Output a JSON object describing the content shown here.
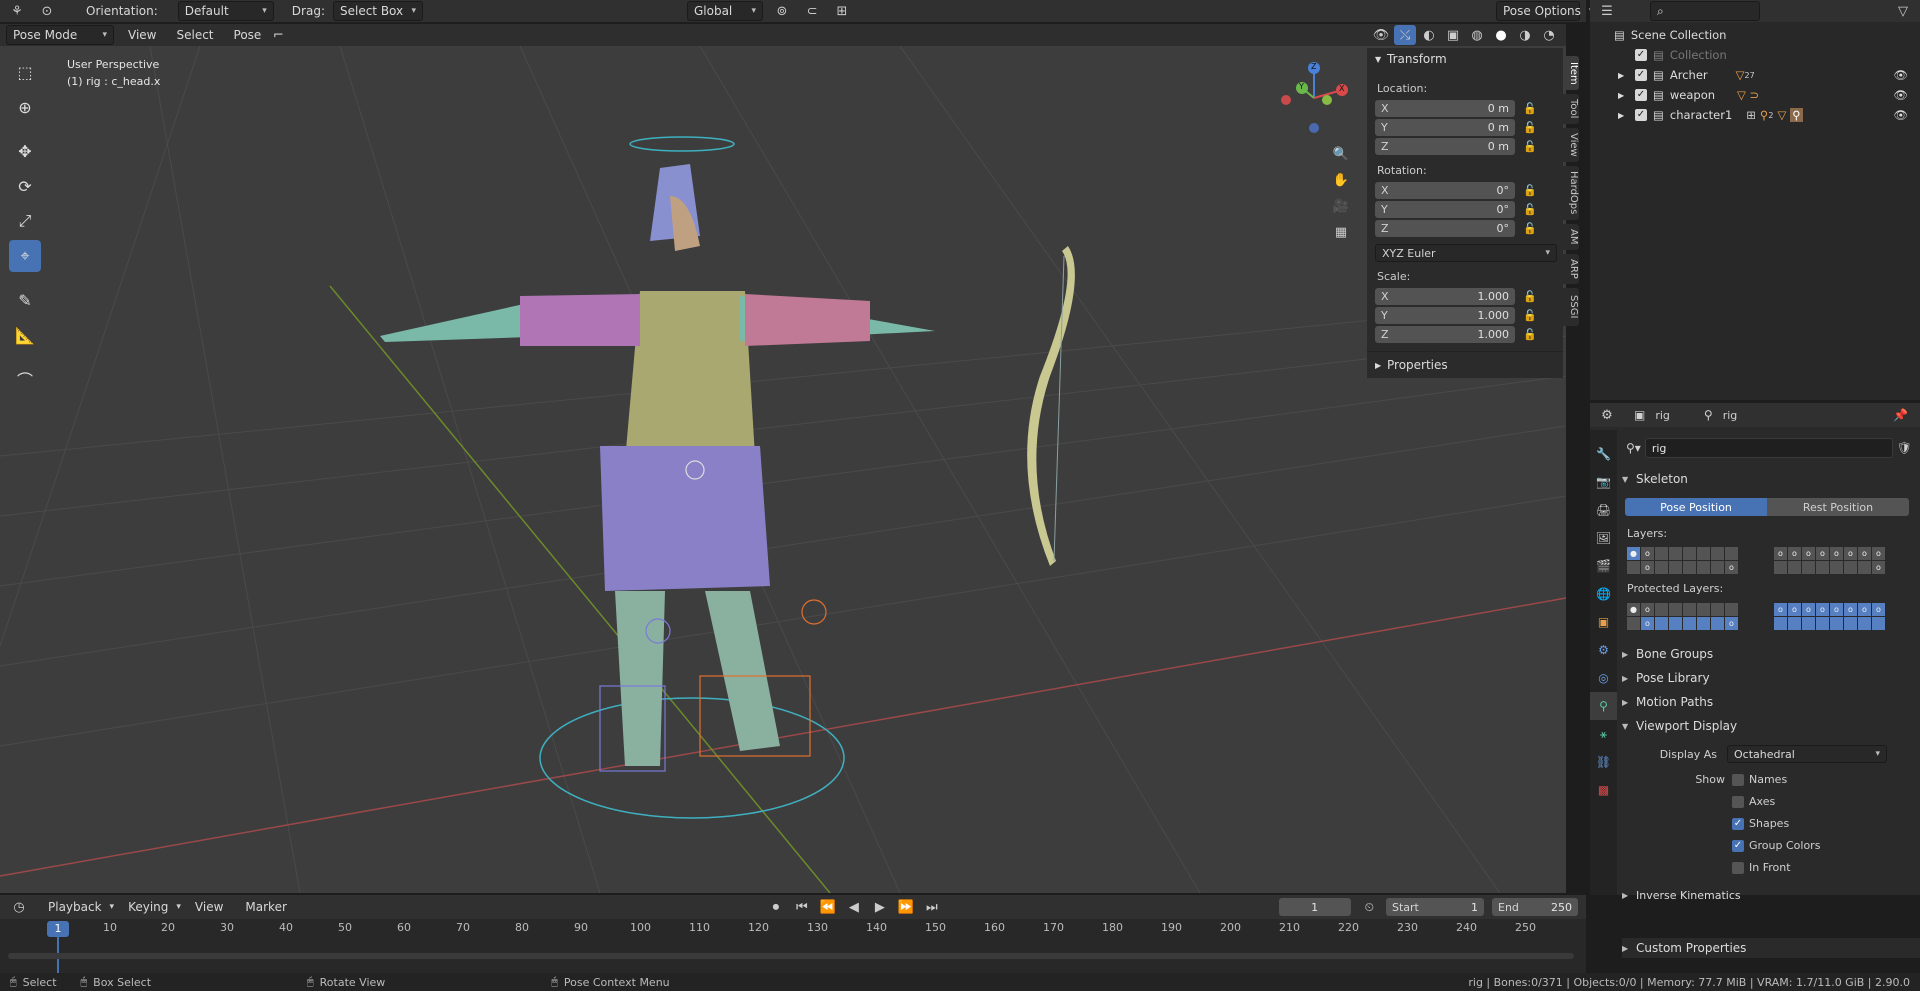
{
  "topbar": {
    "mode_icon": "editor-type-icon",
    "orientation_label": "Orientation:",
    "orientation_value": "Default",
    "drag_label": "Drag:",
    "drag_value": "Select Box",
    "transform_space": "Global",
    "pose_options": "Pose Options"
  },
  "viewport_header": {
    "mode": "Pose Mode",
    "menus": [
      "View",
      "Select",
      "Pose"
    ]
  },
  "viewport": {
    "title": "User Perspective",
    "subtitle": "(1) rig : c_head.x",
    "gizmo": {
      "x": "X",
      "y": "Y",
      "z": "Z"
    }
  },
  "npanel": {
    "transform_title": "Transform",
    "location_label": "Location:",
    "location": [
      {
        "k": "X",
        "v": "0 m"
      },
      {
        "k": "Y",
        "v": "0 m"
      },
      {
        "k": "Z",
        "v": "0 m"
      }
    ],
    "rotation_label": "Rotation:",
    "rotation": [
      {
        "k": "X",
        "v": "0°"
      },
      {
        "k": "Y",
        "v": "0°"
      },
      {
        "k": "Z",
        "v": "0°"
      }
    ],
    "rotation_mode": "XYZ Euler",
    "scale_label": "Scale:",
    "scale": [
      {
        "k": "X",
        "v": "1.000"
      },
      {
        "k": "Y",
        "v": "1.000"
      },
      {
        "k": "Z",
        "v": "1.000"
      }
    ],
    "properties_title": "Properties",
    "tabs": [
      "Item",
      "Tool",
      "View",
      "HardOps",
      "AM",
      "ARP",
      "SSGI"
    ]
  },
  "outliner": {
    "scene_collection": "Scene Collection",
    "items": [
      {
        "name": "Collection",
        "muted": true
      },
      {
        "name": "Archer",
        "badge": "27"
      },
      {
        "name": "weapon",
        "badge": ""
      },
      {
        "name": "character1",
        "badge": "2"
      }
    ]
  },
  "properties": {
    "header_left": "rig",
    "header_right": "rig",
    "datablock": "rig",
    "skeleton_title": "Skeleton",
    "pose_position": "Pose Position",
    "rest_position": "Rest Position",
    "layers_label": "Layers:",
    "protected_label": "Protected Layers:",
    "sections": [
      "Bone Groups",
      "Pose Library",
      "Motion Paths"
    ],
    "viewport_display": "Viewport Display",
    "display_as_label": "Display As",
    "display_as_value": "Octahedral",
    "show_label": "Show",
    "options": [
      {
        "label": "Names",
        "checked": false
      },
      {
        "label": "Axes",
        "checked": false
      },
      {
        "label": "Shapes",
        "checked": true
      },
      {
        "label": "Group Colors",
        "checked": true
      },
      {
        "label": "In Front",
        "checked": false
      }
    ],
    "bottom_sections": [
      "Inverse Kinematics",
      "Custom Properties"
    ]
  },
  "timeline": {
    "menus": [
      "Playback",
      "Keying",
      "View",
      "Marker"
    ],
    "current_frame": "1",
    "start_label": "Start",
    "start": "1",
    "end_label": "End",
    "end": "250",
    "ruler": [
      "1",
      "10",
      "20",
      "30",
      "40",
      "50",
      "60",
      "70",
      "80",
      "90",
      "100",
      "110",
      "120",
      "130",
      "140",
      "150",
      "160",
      "170",
      "180",
      "190",
      "200",
      "210",
      "220",
      "230",
      "240",
      "250"
    ]
  },
  "statusbar": {
    "select": "Select",
    "box_select": "Box Select",
    "rotate_view": "Rotate View",
    "context_menu": "Pose Context Menu",
    "stats": "rig | Bones:0/371 | Objects:0/0 | Memory: 77.7 MiB | VRAM: 1.7/11.0 GiB | 2.90.0"
  },
  "colors": {
    "accent": "#4772b3",
    "viewport_bg": "#3d3d3d",
    "panel_bg": "#2b2b2b"
  }
}
